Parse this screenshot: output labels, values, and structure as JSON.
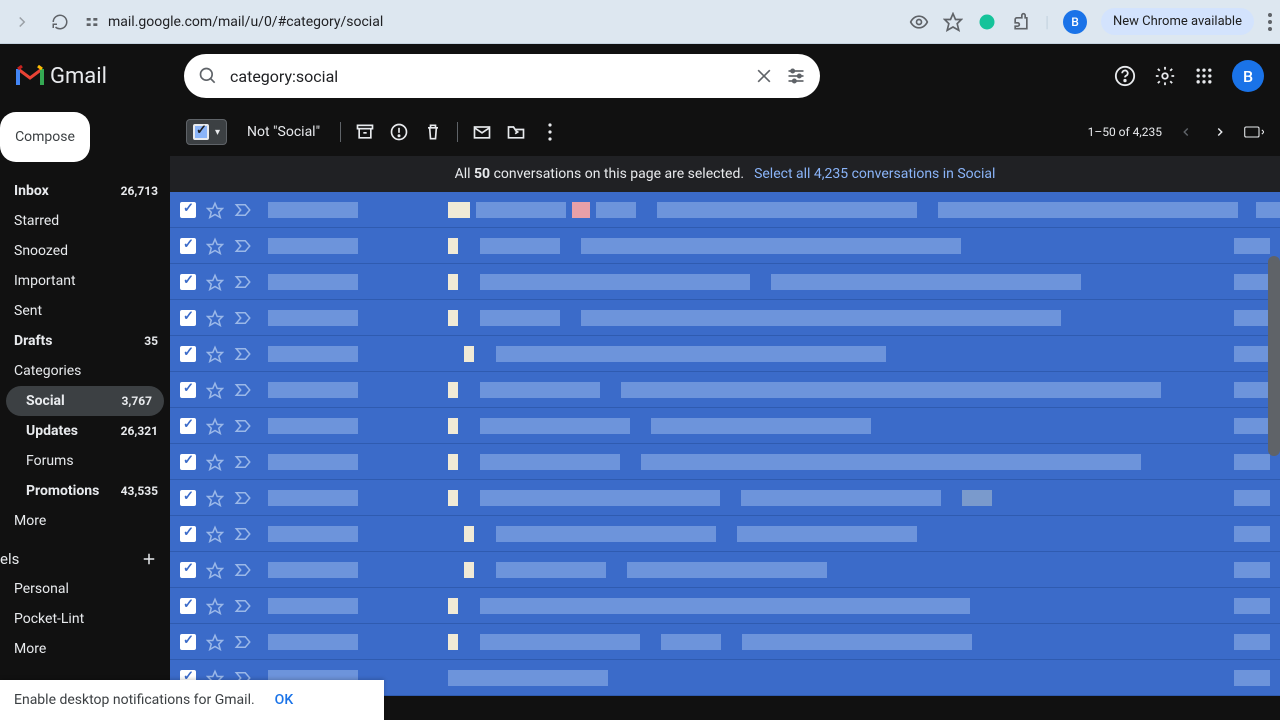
{
  "browser": {
    "url": "mail.google.com/mail/u/0/#category/social",
    "profile_letter": "B",
    "new_chrome": "New Chrome available"
  },
  "header": {
    "app_name": "Gmail",
    "search_value": "category:social",
    "avatar_letter": "B"
  },
  "sidebar": {
    "compose": "Compose",
    "items": [
      {
        "label": "Inbox",
        "count": "26,713",
        "bold": true
      },
      {
        "label": "Starred",
        "count": ""
      },
      {
        "label": "Snoozed",
        "count": ""
      },
      {
        "label": "Important",
        "count": ""
      },
      {
        "label": "Sent",
        "count": ""
      },
      {
        "label": "Drafts",
        "count": "35",
        "bold": true
      },
      {
        "label": "Categories",
        "count": ""
      }
    ],
    "categories": [
      {
        "label": "Social",
        "count": "3,767",
        "bold": true,
        "active": true
      },
      {
        "label": "Updates",
        "count": "26,321",
        "bold": true
      },
      {
        "label": "Forums",
        "count": ""
      },
      {
        "label": "Promotions",
        "count": "43,535",
        "bold": true
      }
    ],
    "more": "More",
    "labels_header": "els",
    "labels": [
      {
        "label": "Personal"
      },
      {
        "label": "Pocket-Lint"
      }
    ],
    "more2": "More"
  },
  "toolbar": {
    "not_social": "Not \"Social\"",
    "page_info": "1–50 of 4,235"
  },
  "banner": {
    "all_prefix": "All ",
    "count": "50",
    "all_suffix": " conversations on this page are selected.",
    "link": "Select all 4,235 conversations in Social"
  },
  "notification": {
    "text": "Enable desktop notifications for Gmail.",
    "ok": "OK"
  }
}
